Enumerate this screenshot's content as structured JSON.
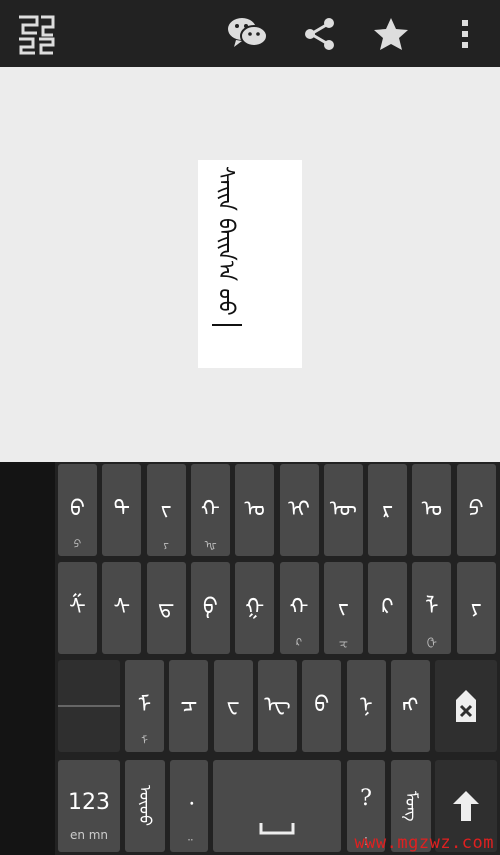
{
  "toolbar": {
    "logo_icon": "mongolian-logo-icon",
    "wechat_icon": "wechat-icon",
    "share_icon": "share-icon",
    "star_icon": "star-icon",
    "more_icon": "more-vert-icon"
  },
  "editor": {
    "text": "ᠰᠠᠢᠨ ᠪᠠᠢᠨ᠎ᠠ ᠤᠤ ?"
  },
  "keyboard": {
    "row1": [
      {
        "g": "ᠪ",
        "s": "ᠫ"
      },
      {
        "g": "ᠲ",
        "s": ""
      },
      {
        "g": "ᠵ",
        "s": "ᠶ"
      },
      {
        "g": "ᠬ",
        "s": "ᠾ"
      },
      {
        "g": "ᠣ",
        "s": ""
      },
      {
        "g": "ᠢ",
        "s": ""
      },
      {
        "g": "ᠥ",
        "s": ""
      },
      {
        "g": "ᠷ",
        "s": ""
      },
      {
        "g": "ᠤ",
        "s": ""
      },
      {
        "g": "ᠫ",
        "s": ""
      }
    ],
    "row2": [
      {
        "g": "ᠱ",
        "s": ""
      },
      {
        "g": "ᠰ",
        "s": ""
      },
      {
        "g": "ᠳ",
        "s": ""
      },
      {
        "g": "ᠹ",
        "s": ""
      },
      {
        "g": "ᠭ",
        "s": ""
      },
      {
        "g": "ᠬ",
        "s": "ᠺ"
      },
      {
        "g": "ᠵ",
        "s": "ᠽ"
      },
      {
        "g": "ᠺ",
        "s": ""
      },
      {
        "g": "ᠯ",
        "s": "ᠿ"
      },
      {
        "g": "ᠶ",
        "s": ""
      }
    ],
    "row3": [
      {
        "g": "ᠮ",
        "s": "ᠮ"
      },
      {
        "g": "ᠴ",
        "s": ""
      },
      {
        "g": "ᠸ",
        "s": ""
      },
      {
        "g": "ᠧ",
        "s": ""
      },
      {
        "g": "ᠪ",
        "s": ""
      },
      {
        "g": "ᠨ",
        "s": ""
      },
      {
        "g": "ᠩ",
        "s": ""
      }
    ],
    "numbers_label": "123",
    "lang_label": "en mn",
    "punct_key": "ᠦᠦᠦ",
    "comma_key": "᠂",
    "comma_sub": "᠃",
    "question_key": "?",
    "question_sub": "!",
    "mongol_key": "ᠮᠣᠩ",
    "backspace_icon": "backspace-icon",
    "enter_icon": "enter-arrow-icon",
    "space_icon": "space-bar-icon"
  },
  "watermark": "www.mgzwz.com"
}
